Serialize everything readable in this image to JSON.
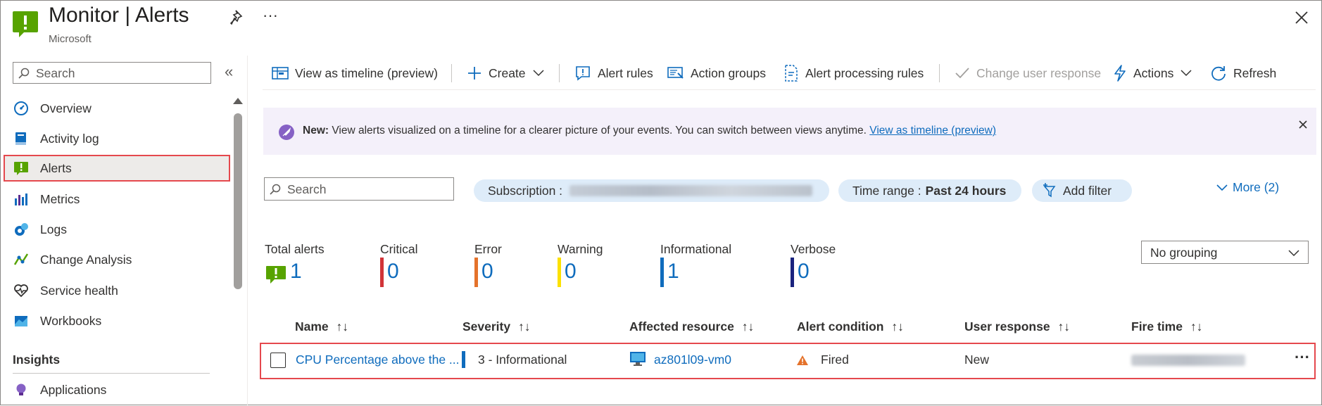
{
  "header": {
    "title": "Monitor | Alerts",
    "subtitle": "Microsoft",
    "pin_icon": "pin-icon",
    "more_icon": "ellipsis-icon",
    "close_icon": "close-icon"
  },
  "sidebar": {
    "search_placeholder": "Search",
    "collapse_label": "«",
    "items": [
      {
        "label": "Overview",
        "icon": "speedometer-icon"
      },
      {
        "label": "Activity log",
        "icon": "book-icon"
      },
      {
        "label": "Alerts",
        "icon": "alert-icon"
      },
      {
        "label": "Metrics",
        "icon": "bar-chart-icon"
      },
      {
        "label": "Logs",
        "icon": "logs-icon"
      },
      {
        "label": "Change Analysis",
        "icon": "change-analysis-icon"
      },
      {
        "label": "Service health",
        "icon": "heart-icon"
      },
      {
        "label": "Workbooks",
        "icon": "workbook-icon"
      }
    ],
    "section_insights": "Insights",
    "insights_items": [
      {
        "label": "Applications",
        "icon": "lightbulb-icon"
      }
    ]
  },
  "toolbar": {
    "view_timeline": "View as timeline (preview)",
    "create": "Create",
    "alert_rules": "Alert rules",
    "action_groups": "Action groups",
    "alert_processing_rules": "Alert processing rules",
    "change_user_response": "Change user response",
    "actions": "Actions",
    "refresh": "Refresh"
  },
  "banner": {
    "bold": "New:",
    "text": "View alerts visualized on a timeline for a clearer picture of your events. You can switch between views anytime.",
    "link": "View as timeline (preview)"
  },
  "filters": {
    "search_placeholder": "Search",
    "subscription_label": "Subscription :",
    "time_range_label": "Time range :",
    "time_range_value": "Past 24 hours",
    "add_filter": "Add filter",
    "more": "More (2)"
  },
  "summary": [
    {
      "label": "Total alerts",
      "value": "1",
      "color": "#57a300"
    },
    {
      "label": "Critical",
      "value": "0",
      "color": "#d13438"
    },
    {
      "label": "Error",
      "value": "0",
      "color": "#e4722b"
    },
    {
      "label": "Warning",
      "value": "0",
      "color": "#fce100"
    },
    {
      "label": "Informational",
      "value": "1",
      "color": "#0f6cbd"
    },
    {
      "label": "Verbose",
      "value": "0",
      "color": "#1a237e"
    }
  ],
  "grouping": {
    "selected": "No grouping"
  },
  "table": {
    "columns": [
      "Name",
      "Severity",
      "Affected resource",
      "Alert condition",
      "User response",
      "Fire time"
    ],
    "sort_glyph": "↑↓",
    "rows": [
      {
        "name": "CPU Percentage above the ...",
        "severity": "3 - Informational",
        "resource": "az801l09-vm0",
        "condition": "Fired",
        "user_response": "New"
      }
    ]
  },
  "colors": {
    "accent": "#0f6cbd",
    "highlight": "#e5484d",
    "banner_bg": "#f4f0fa",
    "pill_bg": "#deecf9"
  }
}
